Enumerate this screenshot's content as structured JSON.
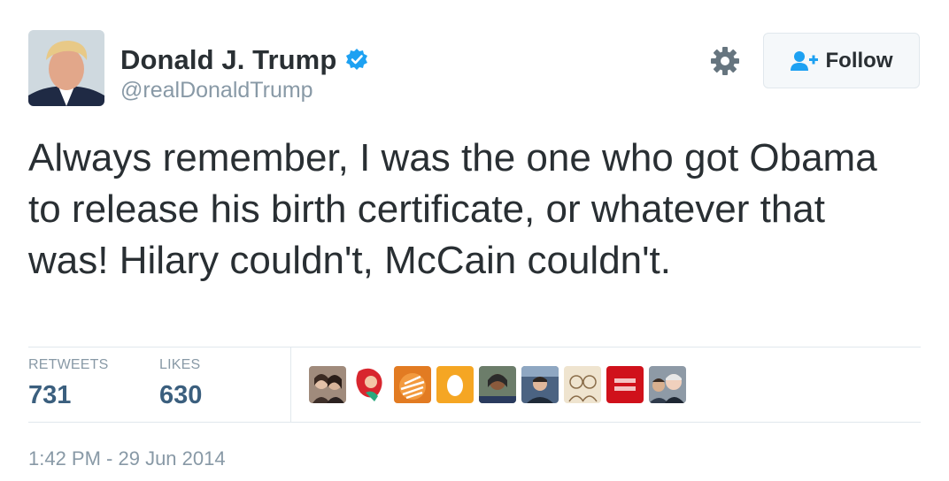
{
  "user": {
    "display_name": "Donald J. Trump",
    "handle": "@realDonaldTrump",
    "verified": true,
    "avatar_icon": "user-avatar-photo"
  },
  "actions": {
    "settings_icon": "gear-icon",
    "follow_label": "Follow",
    "follow_icon": "add-user-icon"
  },
  "tweet": {
    "text": "Always remember, I was the one who got Obama to release his birth certificate, or whatever that was! Hilary couldn't, McCain couldn't."
  },
  "stats": {
    "retweets_label": "RETWEETS",
    "retweets_value": "731",
    "likes_label": "LIKES",
    "likes_value": "630"
  },
  "likers": [
    {
      "icon": "liker-avatar-photo"
    },
    {
      "icon": "liker-avatar-mermaid"
    },
    {
      "icon": "liker-avatar-orange-logo"
    },
    {
      "icon": "liker-avatar-egg"
    },
    {
      "icon": "liker-avatar-photo"
    },
    {
      "icon": "liker-avatar-photo"
    },
    {
      "icon": "liker-avatar-sketch"
    },
    {
      "icon": "liker-avatar-red-equal"
    },
    {
      "icon": "liker-avatar-photo"
    }
  ],
  "timestamp": "1:42 PM - 29 Jun 2014",
  "colors": {
    "text": "#292f33",
    "muted": "#8899a6",
    "stat_value": "#3b5f7e",
    "verified": "#1da1f2",
    "follow_icon": "#1da1f2",
    "divider": "#e1e8ed"
  }
}
